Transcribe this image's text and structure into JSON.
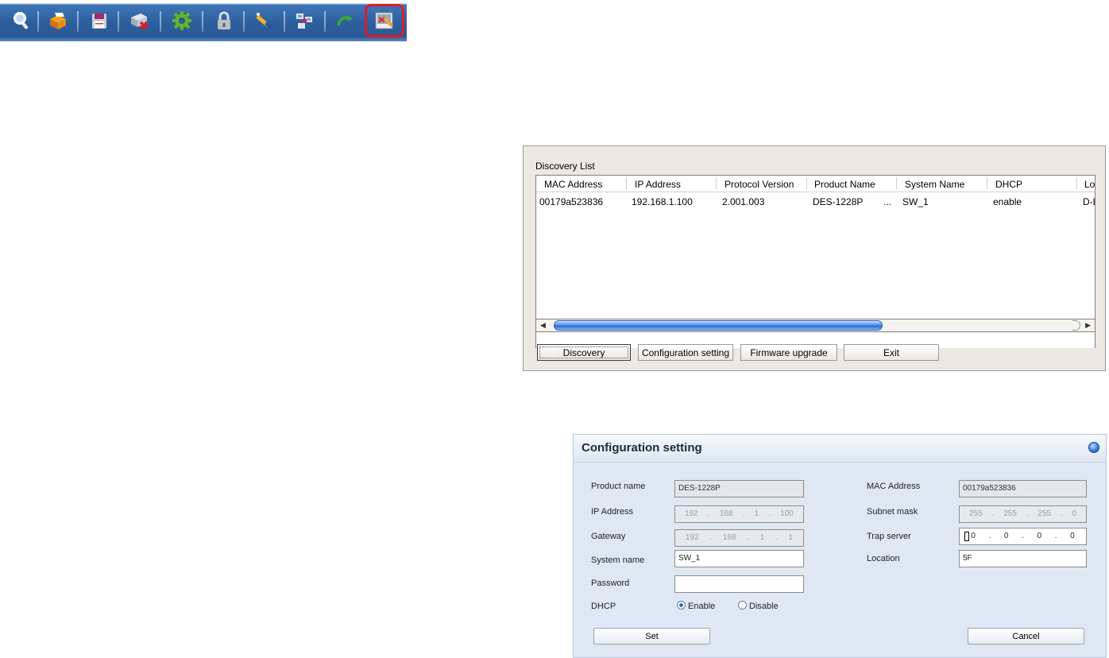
{
  "toolbar": {
    "icons": [
      "search-icon",
      "open-icon",
      "save-icon",
      "delete-device-icon",
      "settings-icon",
      "lock-icon",
      "wand-icon",
      "network-icon",
      "back-icon",
      "config-tool-icon"
    ],
    "highlight_color": "#e01b24"
  },
  "discovery": {
    "title": "Discovery List",
    "columns": [
      "MAC Address",
      "IP Address",
      "Protocol Version",
      "Product Name",
      "System Name",
      "DHCP",
      "Lo"
    ],
    "rows": [
      {
        "mac": "00179a523836",
        "ip": "192.168.1.100",
        "protocol": "2.001.003",
        "product": "DES-1228P",
        "product_more": "...",
        "system": "SW_1",
        "dhcp": "enable",
        "location": "D-L"
      }
    ],
    "buttons": {
      "discovery": "Discovery",
      "configuration": "Configuration setting",
      "firmware": "Firmware upgrade",
      "exit": "Exit"
    },
    "scrollbar_position": 0.62
  },
  "config": {
    "title": "Configuration setting",
    "fields": {
      "product_name": {
        "label": "Product name",
        "value": "DES-1228P"
      },
      "ip_address": {
        "label": "IP Address",
        "value": [
          "192",
          "168",
          "1",
          "100"
        ]
      },
      "gateway": {
        "label": "Gateway",
        "value": [
          "192",
          "168",
          "1",
          "1"
        ]
      },
      "system_name": {
        "label": "System name",
        "value": "SW_1"
      },
      "password": {
        "label": "Password",
        "value": ""
      },
      "dhcp": {
        "label": "DHCP",
        "enable": "Enable",
        "disable": "Disable",
        "selected": "Enable"
      },
      "mac_address": {
        "label": "MAC Address",
        "value": "00179a523836"
      },
      "subnet_mask": {
        "label": "Subnet mask",
        "value": [
          "255",
          "255",
          "255",
          "0"
        ]
      },
      "trap_server": {
        "label": "Trap server",
        "value": [
          "0",
          "0",
          "0",
          "0"
        ]
      },
      "location": {
        "label": "Location",
        "value": "5F"
      }
    },
    "buttons": {
      "set": "Set",
      "cancel": "Cancel"
    }
  }
}
